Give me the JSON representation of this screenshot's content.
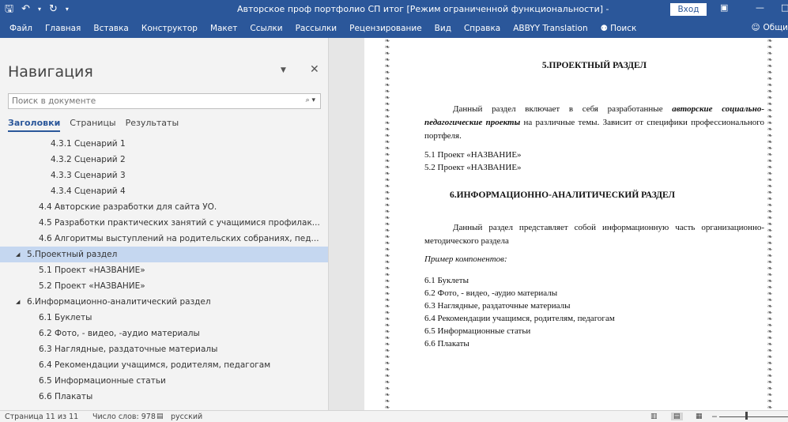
{
  "window": {
    "title": "Авторское проф портфолио СП итог [Режим ограниченной функциональности]  -  Word",
    "signin_label": "Вход"
  },
  "ribbon": {
    "tabs": [
      "Файл",
      "Главная",
      "Вставка",
      "Конструктор",
      "Макет",
      "Ссылки",
      "Рассылки",
      "Рецензирование",
      "Вид",
      "Справка",
      "ABBYY Translation"
    ],
    "search_label": "Поиск",
    "share_label": "Общи"
  },
  "nav": {
    "title": "Навигация",
    "search_placeholder": "Поиск в документе",
    "tabs": [
      "Заголовки",
      "Страницы",
      "Результаты"
    ],
    "items": [
      "4.3.1 Сценарий 1",
      "4.3.2 Сценарий 2",
      "4.3.3 Сценарий 3",
      "4.3.4 Сценарий 4",
      "4.4 Авторские разработки для сайта УО.",
      "4.5 Разработки практических занятий с учащимися профилак...",
      "4.6 Алгоритмы выступлений на родительских собраниях, пед...",
      "5.Проектный раздел",
      "5.1 Проект «НАЗВАНИЕ»",
      "5.2 Проект «НАЗВАНИЕ»",
      "6.Информационно-аналитический раздел",
      "6.1 Буклеты",
      "6.2 Фото, - видео, -аудио материалы",
      "6.3 Наглядные, раздаточные материалы",
      "6.4 Рекомендации учащимся, родителям, педагогам",
      "6.5 Информационные статьи",
      "6.6 Плакаты"
    ]
  },
  "document": {
    "h5": "5.ПРОЕКТНЫЙ РАЗДЕЛ",
    "p5_a": "Данный раздел включает в себя разработанные ",
    "p5_b": "авторские социально-педагогические проекты",
    "p5_c": " на различные темы. Зависит от специфики профессионального портфеля.",
    "l51": "5.1 Проект «НАЗВАНИЕ»",
    "l52": "5.2 Проект «НАЗВАНИЕ»",
    "h6": "6.ИНФОРМАЦИОННО-АНАЛИТИЧЕСКИЙ РАЗДЕЛ",
    "p6": "Данный раздел представляет собой информационную часть организационно-методического раздела",
    "example": "Пример компонентов:",
    "list6": [
      "6.1 Буклеты",
      "6.2 Фото, - видео, -аудио материалы",
      "6.3 Наглядные, раздаточные материалы",
      "6.4 Рекомендации учащимся, родителям, педагогам",
      "6.5 Информационные статьи",
      "6.6 Плакаты"
    ]
  },
  "status": {
    "page": "Страница 11 из 11",
    "words": "Число слов: 978",
    "language": "русский"
  }
}
